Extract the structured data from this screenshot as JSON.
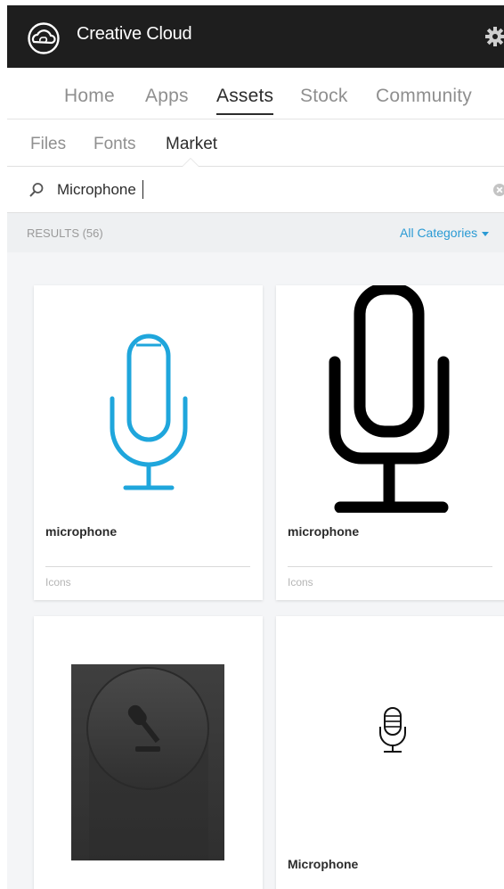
{
  "app": {
    "title": "Creative Cloud"
  },
  "main_nav": {
    "tabs": [
      {
        "label": "Home"
      },
      {
        "label": "Apps"
      },
      {
        "label": "Assets"
      },
      {
        "label": "Stock"
      },
      {
        "label": "Community"
      }
    ],
    "active": "Assets"
  },
  "sub_nav": {
    "tabs": [
      {
        "label": "Files"
      },
      {
        "label": "Fonts"
      },
      {
        "label": "Market"
      }
    ],
    "active": "Market"
  },
  "search": {
    "value": "Microphone"
  },
  "results": {
    "count_label": "RESULTS (56)",
    "category_filter": "All Categories"
  },
  "cards": [
    {
      "name": "microphone",
      "category": "Icons",
      "icon": "microphone-outline-blue-icon"
    },
    {
      "name": "microphone",
      "category": "Icons",
      "icon": "microphone-bold-black-icon"
    },
    {
      "name": "",
      "category": "",
      "icon": "microphone-dark-button-icon"
    },
    {
      "name": "Microphone",
      "category": "",
      "icon": "microphone-vintage-small-icon"
    }
  ],
  "colors": {
    "titlebar_bg": "#1e1e1e",
    "accent_blue": "#2a9ad4",
    "icon_blue": "#1fa6dc"
  }
}
